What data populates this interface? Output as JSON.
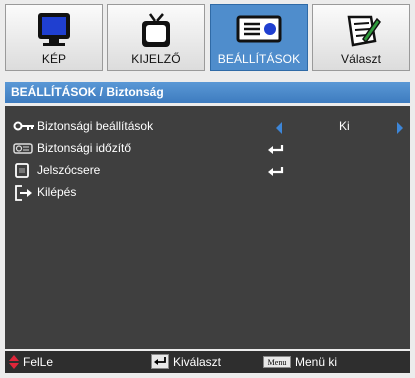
{
  "tabs": [
    {
      "label": "KÉP",
      "icon": "monitor-icon",
      "active": false
    },
    {
      "label": "KIJELZŐ",
      "icon": "tv-icon",
      "active": false
    },
    {
      "label": "BEÁLLÍTÁSOK",
      "icon": "projector-icon",
      "active": true
    },
    {
      "label": "Választ",
      "icon": "options-icon",
      "active": false
    }
  ],
  "header": {
    "title": "BEÁLLÍTÁSOK / Biztonság"
  },
  "menu": {
    "items": [
      {
        "label": "Biztonsági beállítások",
        "icon": "key-icon",
        "value": "Ki",
        "control": "selector"
      },
      {
        "label": "Biztonsági időzítő",
        "icon": "timer-icon",
        "control": "enter"
      },
      {
        "label": "Jelszócsere",
        "icon": "lock-icon",
        "control": "enter"
      },
      {
        "label": "Kilépés",
        "icon": "exit-icon",
        "control": "none"
      }
    ]
  },
  "footer": {
    "nav_label": "FelLe",
    "select_label": "Kiválaszt",
    "menu_key": "Menu",
    "menu_label": "Menü ki"
  },
  "colors": {
    "accent": "#3e7cbf",
    "panel": "#3f3f3f",
    "footer_up_arrow": "#e0263a"
  }
}
